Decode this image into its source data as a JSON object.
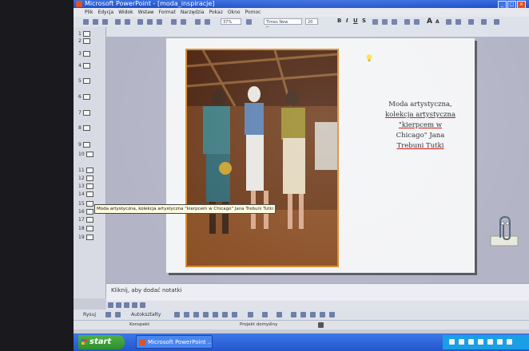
{
  "window": {
    "title": "Microsoft PowerPoint - [moda_inspiracje]"
  },
  "menu": [
    "Plik",
    "Edycja",
    "Widok",
    "Wstaw",
    "Format",
    "Narzędzia",
    "Pokaz",
    "Okno",
    "Pomoc"
  ],
  "toolbar": {
    "zoom": "37%",
    "font": "Times New Roman",
    "font_size": "20"
  },
  "outline": {
    "slide_numbers": [
      "1",
      "2",
      "3",
      "4",
      "5",
      "6",
      "7",
      "8",
      "9",
      "10",
      "11",
      "12",
      "13",
      "14",
      "15",
      "16",
      "17",
      "18",
      "19"
    ]
  },
  "tooltip": "Moda artystyczna, kolekcja artystyczna \"kierpcem w Chicago\" Jana Trebuni Tutki",
  "slide": {
    "caption_lines": [
      "Moda artystyczna,",
      "kolekcja artystyczna",
      "\"kierpcem w",
      "Chicago\" Jana",
      "Trebuni Tutki"
    ]
  },
  "notes": {
    "placeholder": "Kliknij, aby dodać notatki"
  },
  "drawing": {
    "draw_label": "Rysuj",
    "autoshapes_label": "Autokształty"
  },
  "status": {
    "left": "Konspekt",
    "middle": "Projekt domyślny"
  },
  "taskbar": {
    "start_label": "start",
    "task_label": "Microsoft PowerPoint ..."
  },
  "colors": {
    "title_bar": "#1f4fc8",
    "taskbar": "#2456cc",
    "start_button": "#2f8f2c",
    "photo_border": "#d98a2c"
  }
}
